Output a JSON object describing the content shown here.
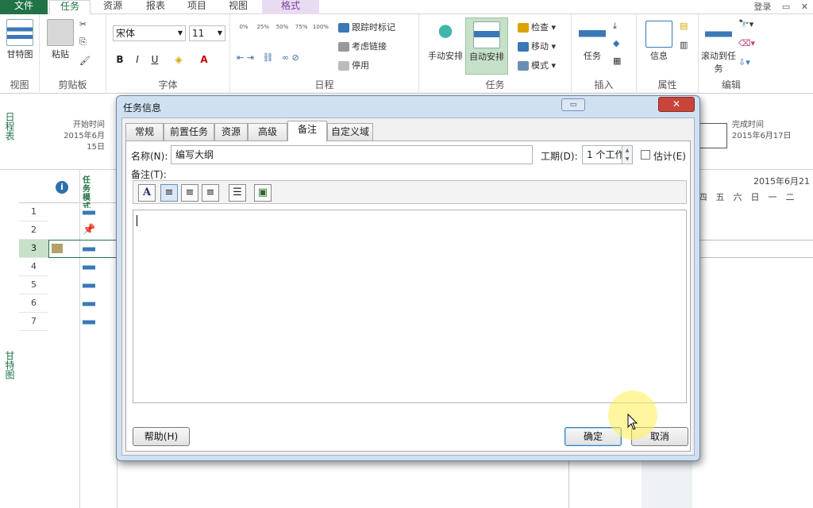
{
  "ribbon_tabs": [
    "文件",
    "任务",
    "资源",
    "报表",
    "项目",
    "视图",
    "格式"
  ],
  "topright": {
    "login": "登录",
    "restore_icon": "restore-icon",
    "close_icon": "close-icon"
  },
  "groups": {
    "view": {
      "label": "视图",
      "gantt": "甘特图"
    },
    "clipboard": {
      "label": "剪贴板",
      "paste": "粘贴"
    },
    "font": {
      "label": "字体",
      "font_name": "宋体",
      "font_size": "11",
      "bold": "B",
      "italic": "I",
      "underline": "U",
      "font_color": "A"
    },
    "schedule": {
      "label": "日程",
      "percents": [
        "0%",
        "25%",
        "50%",
        "75%",
        "100%"
      ],
      "mark_on_track": "跟踪时标记",
      "respect_links": "考虑链接",
      "inactivate": "停用"
    },
    "tasks": {
      "label": "任务",
      "manual": "手动安排",
      "auto": "自动安排",
      "inspect": "检查",
      "move": "移动",
      "mode": "模式"
    },
    "insert": {
      "label": "插入",
      "task": "任务"
    },
    "properties": {
      "label": "属性",
      "info": "信息"
    },
    "editing": {
      "label": "编辑",
      "scroll_to": "滚动到任务"
    }
  },
  "timeline": {
    "side_label": "日程表",
    "start_label": "开始时间",
    "start_date": "2015年6月15日",
    "finish_label": "完成时间",
    "finish_date": "2015年6月17日"
  },
  "gantt": {
    "side_label": "甘特图",
    "info_header": "i",
    "mode_header": "任务模式",
    "rows": [
      "1",
      "2",
      "3",
      "4",
      "5",
      "6",
      "7"
    ],
    "selected_row": "3",
    "calendar_week": "2015年6月21",
    "days": [
      "四",
      "五",
      "六",
      "日",
      "一",
      "二"
    ]
  },
  "dialog": {
    "title": "任务信息",
    "close": "✕",
    "tabs": [
      "常规",
      "前置任务",
      "资源",
      "高级",
      "备注",
      "自定义域"
    ],
    "active_tab": "备注",
    "name_label": "名称(N):",
    "name_value": "编写大纲",
    "duration_label": "工期(D):",
    "duration_value": "1 个工作",
    "estimated_label": "估计(E)",
    "notes_label": "备注(T):",
    "notes_value": "",
    "format_buttons": [
      "A",
      "≡",
      "≡",
      "≡",
      "☰",
      "▣"
    ],
    "help": "帮助(H)",
    "ok": "确定",
    "cancel": "取消"
  },
  "colors": {
    "accent": "#217346",
    "dialog_frame": "#cfe0f1",
    "close_red": "#c9453a",
    "selection": "#c6e0c9"
  }
}
